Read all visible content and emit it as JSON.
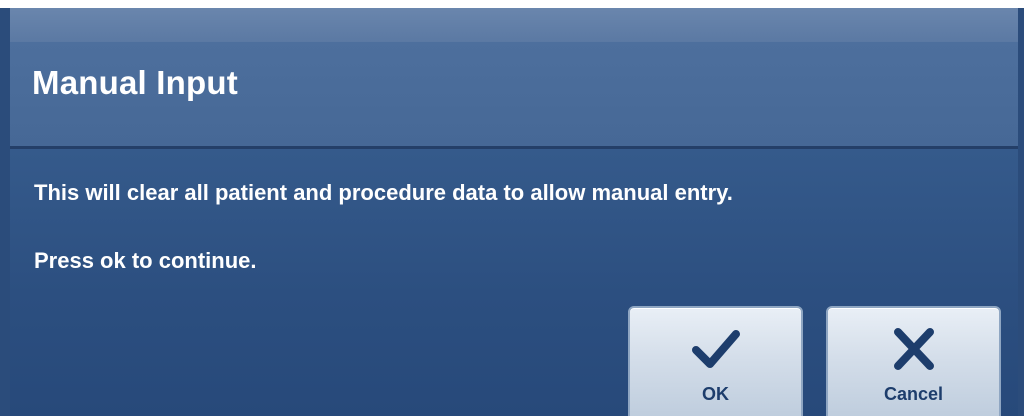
{
  "dialog": {
    "title": "Manual Input",
    "message_line1": "This will clear all patient and procedure data to allow manual entry.",
    "message_line2": "Press ok to continue."
  },
  "buttons": {
    "ok": {
      "label": "OK",
      "icon": "checkmark-icon"
    },
    "cancel": {
      "label": "Cancel",
      "icon": "close-icon"
    }
  },
  "colors": {
    "dialog_background": "#355a8b",
    "header_background": "#4d6f9d",
    "button_face": "#d3dde9",
    "icon_color": "#1d3d6c"
  }
}
